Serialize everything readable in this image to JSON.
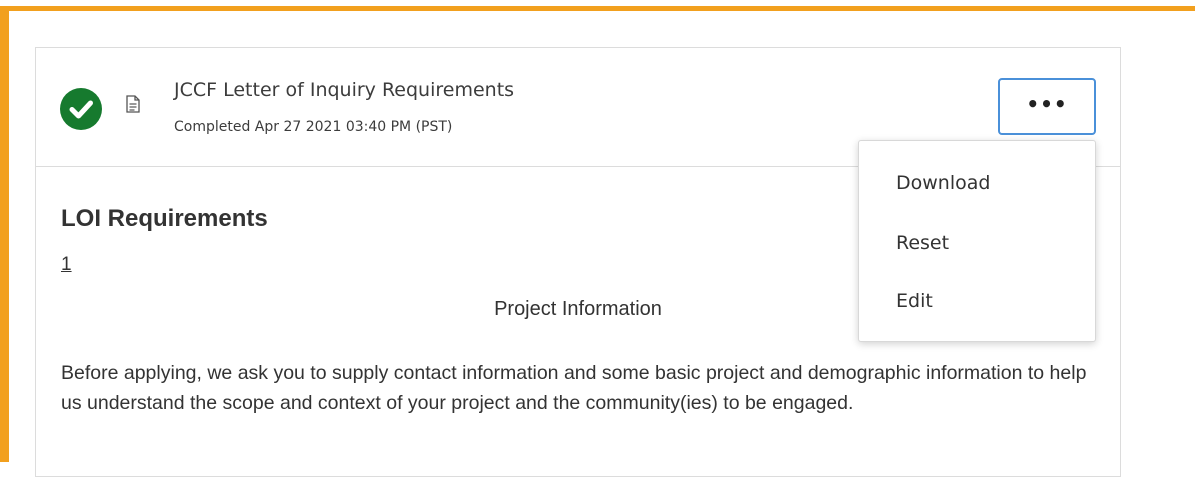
{
  "document": {
    "title": "JCCF Letter of Inquiry Requirements",
    "status": "Completed Apr 27 2021 03:40 PM (PST)",
    "status_color": "#167a2e",
    "more_label": "•••"
  },
  "content": {
    "section_title": "LOI Requirements",
    "page_number": "1",
    "heading": "Project Information",
    "paragraph": "Before applying, we ask you to supply contact information and some basic project and demographic information to help us understand the scope and context of your project and the community(ies) to be engaged."
  },
  "menu": {
    "items": [
      {
        "label": "Download"
      },
      {
        "label": "Reset"
      },
      {
        "label": "Edit"
      }
    ]
  },
  "colors": {
    "focus_outline": "#f2a01e",
    "button_border": "#4a90d9"
  }
}
